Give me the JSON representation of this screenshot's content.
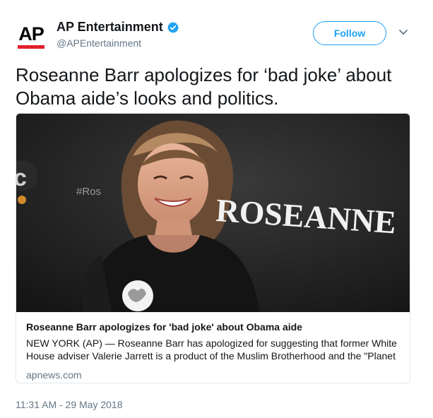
{
  "header": {
    "logo_text": "AP",
    "display_name": "AP Entertainment",
    "handle": "@APEntertainment",
    "follow_label": "Follow"
  },
  "tweet": {
    "text": "Roseanne Barr apologizes for ‘bad joke’ about Obama aide’s looks and politics.",
    "timestamp": "11:31 AM - 29 May 2018"
  },
  "card": {
    "image_backdrop_text": "ROSEANNE",
    "image_hashtag_text": "#Ros",
    "title": "Roseanne Barr apologizes for 'bad joke' about Obama aide",
    "description_line1": "NEW YORK (AP) — Roseanne Barr has apologized for suggesting that former White",
    "description_line2": "House adviser Valerie Jarrett is a product of the Muslim Brotherhood and the \"Planet",
    "domain": "apnews.com"
  },
  "colors": {
    "accent": "#1da1f2",
    "ap_red": "#e41e2b",
    "secondary_text": "#657786",
    "border": "#e1e8ed"
  },
  "icons": {
    "verified": "verified-badge-icon",
    "caret": "chevron-down-icon"
  }
}
